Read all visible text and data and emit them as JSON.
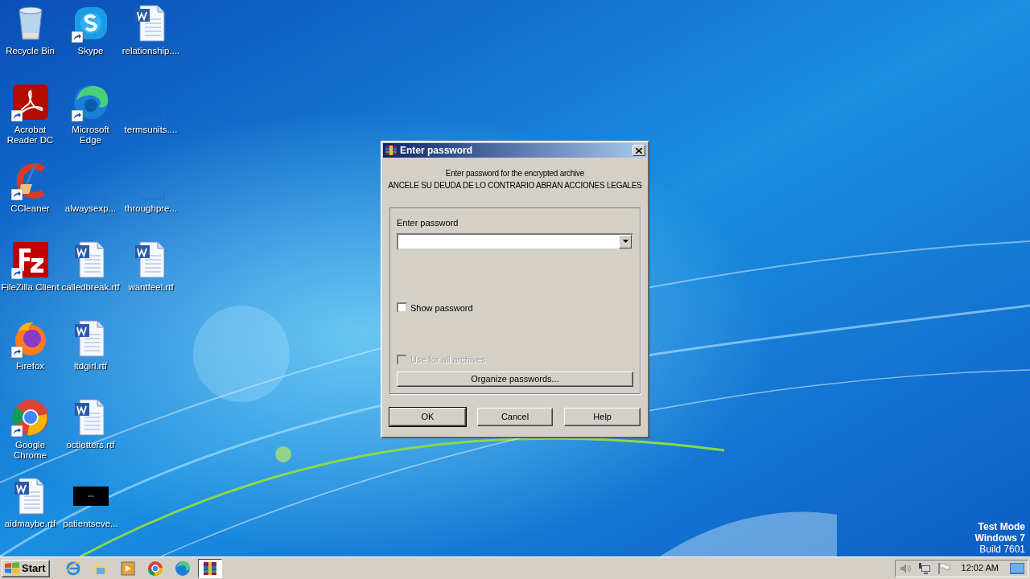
{
  "desktop": {
    "icons": [
      {
        "label": "Recycle Bin",
        "kind": "recycle",
        "shortcut": false
      },
      {
        "label": "Acrobat Reader DC",
        "kind": "pdf",
        "shortcut": true
      },
      {
        "label": "CCleaner",
        "kind": "ccleaner",
        "shortcut": true
      },
      {
        "label": "FileZilla Client",
        "kind": "filezilla",
        "shortcut": true
      },
      {
        "label": "Firefox",
        "kind": "firefox",
        "shortcut": true
      },
      {
        "label": "Google Chrome",
        "kind": "chrome",
        "shortcut": true
      },
      {
        "label": "aidmaybe.rtf",
        "kind": "word",
        "shortcut": false
      },
      {
        "label": "Skype",
        "kind": "skype",
        "shortcut": true
      },
      {
        "label": "Microsoft Edge",
        "kind": "edge",
        "shortcut": true
      },
      {
        "label": "alwaysexp...",
        "kind": "blank",
        "shortcut": false
      },
      {
        "label": "calledbreak.rtf",
        "kind": "word",
        "shortcut": false
      },
      {
        "label": "ltdgirl.rtf",
        "kind": "word",
        "shortcut": false
      },
      {
        "label": "octletters.rtf",
        "kind": "word",
        "shortcut": false
      },
      {
        "label": "patientseve...",
        "kind": "black",
        "shortcut": false
      },
      {
        "label": "relationship....",
        "kind": "word",
        "shortcut": false
      },
      {
        "label": "termsunits....",
        "kind": "blank",
        "shortcut": false
      },
      {
        "label": "throughpre...",
        "kind": "blank",
        "shortcut": false
      },
      {
        "label": "wantfeel.rtf",
        "kind": "word",
        "shortcut": false
      }
    ],
    "system_text": [
      "Test Mode",
      "Windows 7",
      "Build 7601"
    ]
  },
  "dialog": {
    "title": "Enter password",
    "message": [
      "Enter password for the encrypted archive",
      "ANCELE SU DEUDA DE LO CONTRARIO ABRAN ACCIONES LEGALES"
    ],
    "password_label": "Enter password",
    "show_password": {
      "label": "Show password",
      "checked": false,
      "disabled": false
    },
    "use_for_all": {
      "label": "Use for all archives",
      "checked": false,
      "disabled": true
    },
    "organize_button": "Organize passwords...",
    "buttons": [
      {
        "label": "OK",
        "default": true
      },
      {
        "label": "Cancel",
        "default": false
      },
      {
        "label": "Help",
        "default": false
      }
    ]
  },
  "taskbar": {
    "start": "Start",
    "apps": [
      {
        "kind": "ie",
        "active": false
      },
      {
        "kind": "folder",
        "active": false
      },
      {
        "kind": "media",
        "active": false
      },
      {
        "kind": "chrome",
        "active": false
      },
      {
        "kind": "edge",
        "active": false
      },
      {
        "kind": "winrar",
        "active": true
      }
    ],
    "clock": "12:02 AM"
  }
}
